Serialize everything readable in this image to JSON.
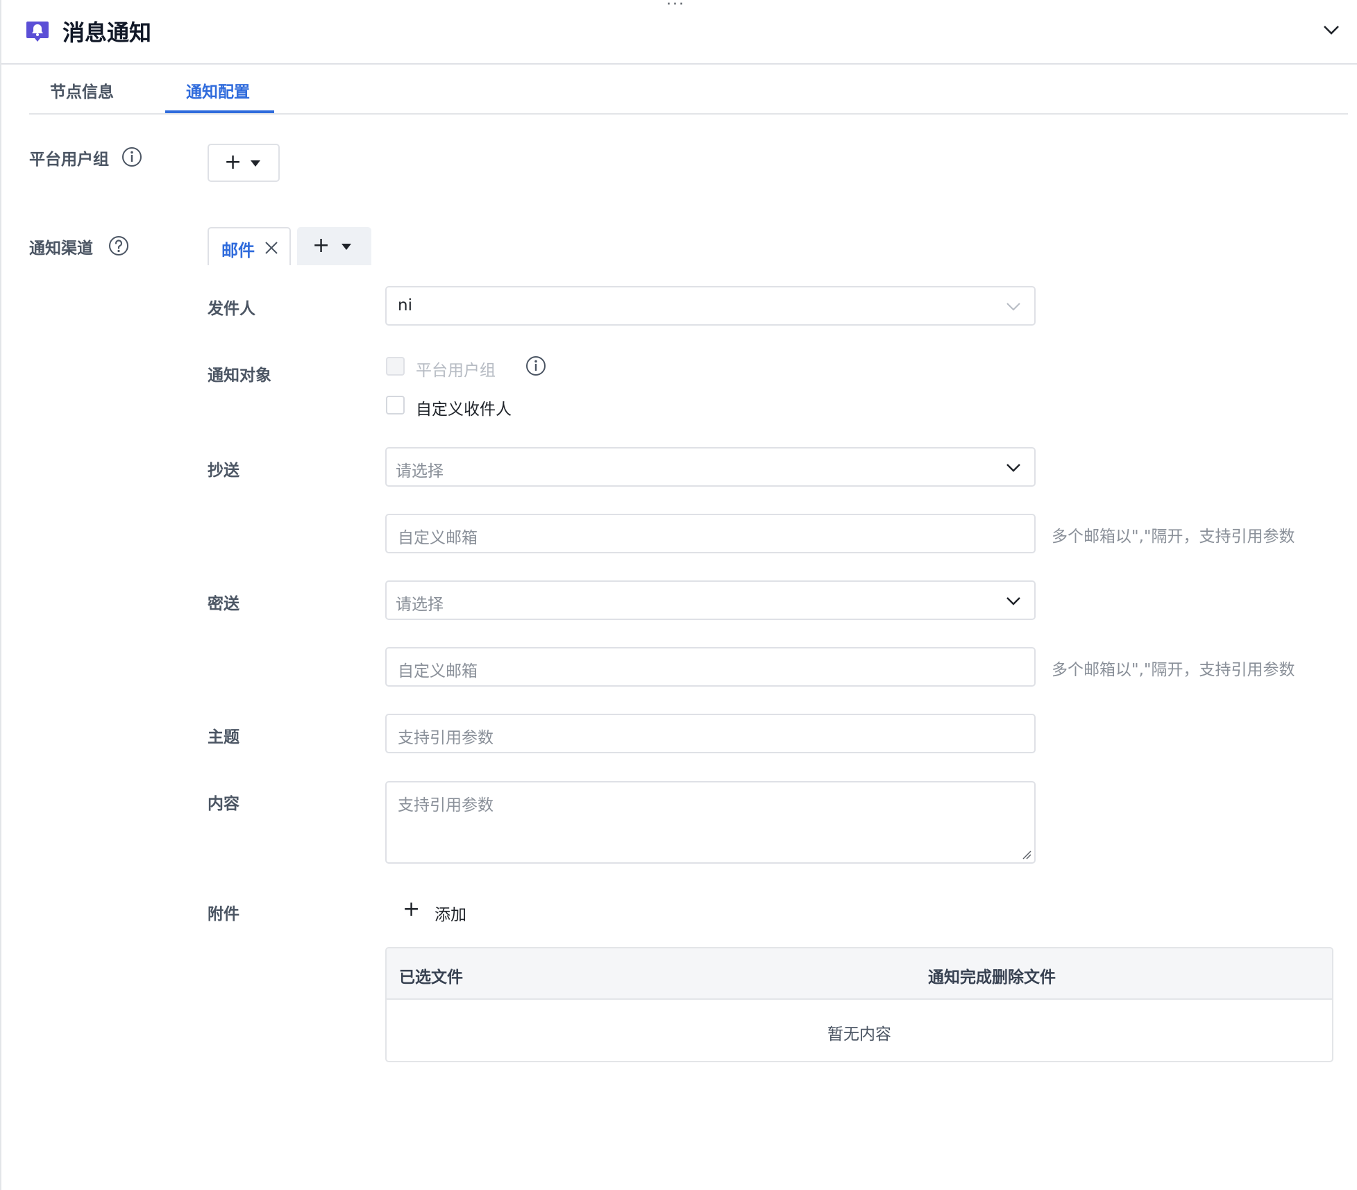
{
  "header": {
    "title": "消息通知",
    "icon": "bell-icon",
    "collapse_icon": "chevron-down-icon",
    "icon_color": "#5b4fd6"
  },
  "tabs": [
    {
      "label": "节点信息",
      "active": false
    },
    {
      "label": "通知配置",
      "active": true
    }
  ],
  "platform_user_group": {
    "label": "平台用户组",
    "icon": "info-icon"
  },
  "notify_channel": {
    "label": "通知渠道",
    "icon": "help-icon",
    "channels": [
      {
        "label": "邮件"
      }
    ]
  },
  "email_form": {
    "sender": {
      "label": "发件人",
      "value": "ni"
    },
    "recipients": {
      "label": "通知对象",
      "options": [
        {
          "label": "平台用户组",
          "checked": false,
          "disabled": true
        },
        {
          "label": "自定义收件人",
          "checked": false,
          "disabled": false
        }
      ]
    },
    "cc": {
      "label": "抄送",
      "select_placeholder": "请选择",
      "custom_placeholder": "自定义邮箱",
      "hint": "多个邮箱以\",\"隔开，支持引用参数"
    },
    "bcc": {
      "label": "密送",
      "select_placeholder": "请选择",
      "custom_placeholder": "自定义邮箱",
      "hint": "多个邮箱以\",\"隔开，支持引用参数"
    },
    "subject": {
      "label": "主题",
      "placeholder": "支持引用参数"
    },
    "content": {
      "label": "内容",
      "placeholder": "支持引用参数"
    },
    "attachments": {
      "label": "附件",
      "add_label": "添加",
      "columns": [
        "已选文件",
        "通知完成删除文件"
      ],
      "empty_text": "暂无内容"
    }
  },
  "colors": {
    "accent": "#2f6bdc",
    "border": "#dfe1e6"
  }
}
